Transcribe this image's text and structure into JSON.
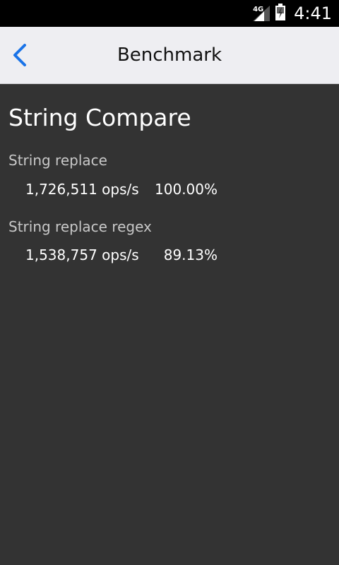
{
  "status_bar": {
    "network": "4G",
    "time": "4:41",
    "icons": [
      "signal-icon",
      "battery-icon"
    ]
  },
  "app_bar": {
    "title": "Benchmark",
    "back_icon": "chevron-left-icon",
    "accent_color": "#1a73e8"
  },
  "main": {
    "section_title": "String Compare",
    "cases": [
      {
        "label": "String replace",
        "ops": "1,726,511 ops/s",
        "percent": "100.00%"
      },
      {
        "label": "String replace regex",
        "ops": "1,538,757 ops/s",
        "percent": "89.13%"
      }
    ]
  }
}
